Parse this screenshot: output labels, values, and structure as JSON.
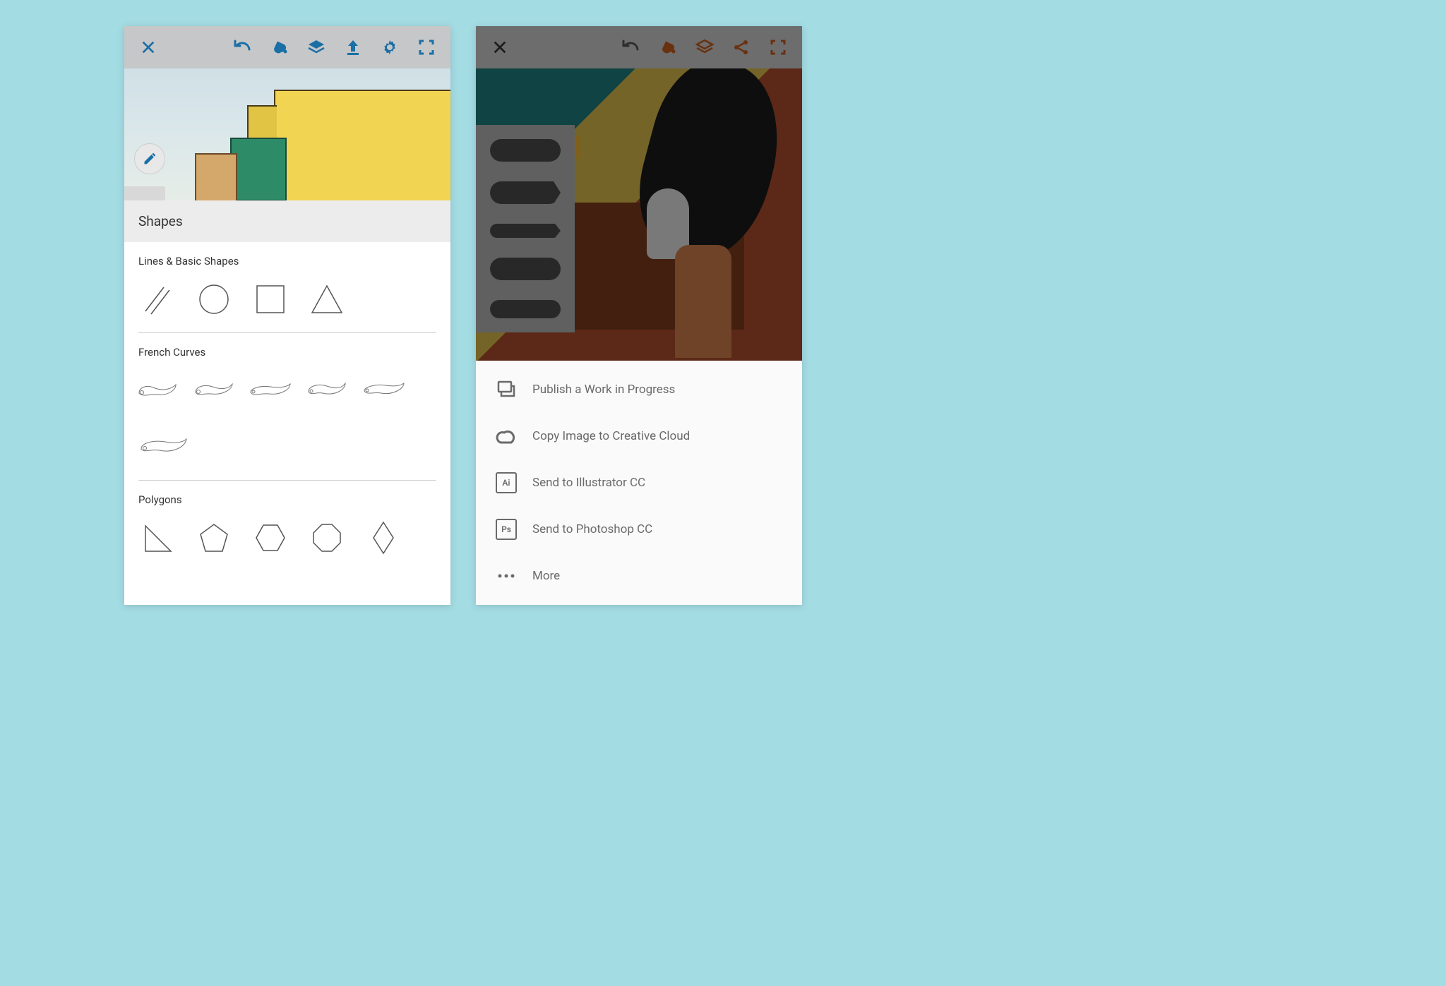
{
  "left": {
    "toolbar_icons": [
      "close",
      "undo",
      "fill",
      "layers",
      "upload",
      "settings",
      "fullscreen"
    ],
    "fab_icon": "pencil",
    "panel_title": "Shapes",
    "sections": [
      {
        "title": "Lines & Basic Shapes",
        "shapes": [
          "parallel-lines",
          "circle",
          "square",
          "triangle"
        ]
      },
      {
        "title": "French Curves",
        "shapes": [
          "curve-1",
          "curve-2",
          "curve-3",
          "curve-4",
          "curve-5",
          "curve-6"
        ]
      },
      {
        "title": "Polygons",
        "shapes": [
          "right-triangle",
          "pentagon",
          "hexagon",
          "octagon",
          "rhombus"
        ]
      }
    ]
  },
  "right": {
    "toolbar_icons": [
      "close",
      "undo",
      "fill",
      "layers",
      "share",
      "fullscreen"
    ],
    "share_menu": [
      {
        "icon": "publish",
        "label": "Publish a Work in Progress"
      },
      {
        "icon": "cc",
        "label": "Copy Image to Creative Cloud"
      },
      {
        "icon": "Ai",
        "label": "Send to Illustrator CC"
      },
      {
        "icon": "Ps",
        "label": "Send to Photoshop CC"
      },
      {
        "icon": "more",
        "label": "More"
      }
    ]
  }
}
